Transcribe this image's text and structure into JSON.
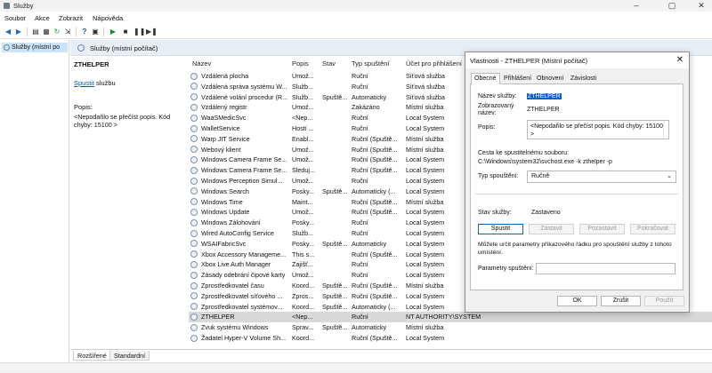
{
  "window": {
    "title": "Služby",
    "controls": [
      "–",
      "▢",
      "✕"
    ]
  },
  "menu": [
    "Soubor",
    "Akce",
    "Zobrazit",
    "Nápověda"
  ],
  "toolbar": {
    "icons": [
      "back-arrow-icon",
      "forward-arrow-icon",
      "console-tree-icon",
      "properties-icon",
      "refresh-icon",
      "export-icon",
      "help-icon",
      "show-action-pane-icon",
      "play-icon",
      "stop-icon",
      "pause-icon",
      "restart-icon"
    ]
  },
  "tree": {
    "selected": "Služby (místní po"
  },
  "main": {
    "header": "Služby (místní počítač)",
    "description": {
      "service_name": "ZTHELPER",
      "start_link": "Spustit",
      "start_suffix": " službu",
      "popis_label": "Popis:",
      "popis_text": "<Nepodařilo se přečíst popis. Kód chyby: 15100 >"
    },
    "columns": [
      "Název",
      "Popis",
      "Stav",
      "Typ spuštění",
      "Účet pro přihlášení"
    ],
    "rows": [
      {
        "name": "Vzdálená plocha",
        "desc": "Umož...",
        "status": "",
        "startup": "Ruční",
        "account": "Síťová služba"
      },
      {
        "name": "Vzdálená správa systému W...",
        "desc": "Služb...",
        "status": "",
        "startup": "Ruční",
        "account": "Síťová služba"
      },
      {
        "name": "Vzdálené volání procedur (R...",
        "desc": "Služb...",
        "status": "Spuště...",
        "startup": "Automaticky",
        "account": "Síťová služba"
      },
      {
        "name": "Vzdálený registr",
        "desc": "Umož...",
        "status": "",
        "startup": "Zakázáno",
        "account": "Místní služba"
      },
      {
        "name": "WaaSMedicSvc",
        "desc": "<Nep...",
        "status": "",
        "startup": "Ruční",
        "account": "Local System"
      },
      {
        "name": "WalletService",
        "desc": "Hostí ...",
        "status": "",
        "startup": "Ruční",
        "account": "Local System"
      },
      {
        "name": "Warp JIT Service",
        "desc": "Enabl...",
        "status": "",
        "startup": "Ruční (Spuště...",
        "account": "Místní služba"
      },
      {
        "name": "Webový klient",
        "desc": "Umož...",
        "status": "",
        "startup": "Ruční (Spuště...",
        "account": "Místní služba"
      },
      {
        "name": "Windows Camera Frame Se...",
        "desc": "Umož...",
        "status": "",
        "startup": "Ruční (Spuště...",
        "account": "Local System"
      },
      {
        "name": "Windows Camera Frame Se...",
        "desc": "Sleduj...",
        "status": "",
        "startup": "Ruční (Spuště...",
        "account": "Local System"
      },
      {
        "name": "Windows Perception Simul...",
        "desc": "Umož...",
        "status": "",
        "startup": "Ruční",
        "account": "Local System"
      },
      {
        "name": "Windows Search",
        "desc": "Posky...",
        "status": "Spuště...",
        "startup": "Automaticky (...",
        "account": "Local System"
      },
      {
        "name": "Windows Time",
        "desc": "Maint...",
        "status": "",
        "startup": "Ruční (Spuště...",
        "account": "Místní služba"
      },
      {
        "name": "Windows Update",
        "desc": "Umož...",
        "status": "",
        "startup": "Ruční (Spuště...",
        "account": "Local System"
      },
      {
        "name": "Windows Zálohování",
        "desc": "Posky...",
        "status": "",
        "startup": "Ruční",
        "account": "Local System"
      },
      {
        "name": "Wired AutoConfig Service",
        "desc": "Služb...",
        "status": "",
        "startup": "Ruční",
        "account": "Local System"
      },
      {
        "name": "WSAIFabricSvc",
        "desc": "Posky...",
        "status": "Spuště...",
        "startup": "Automaticky",
        "account": "Local System"
      },
      {
        "name": "Xbox Accessory Manageme...",
        "desc": "This s...",
        "status": "",
        "startup": "Ruční (Spuště...",
        "account": "Local System"
      },
      {
        "name": "Xbox Live Auth Manager",
        "desc": "Zajišť...",
        "status": "",
        "startup": "Ruční",
        "account": "Local System"
      },
      {
        "name": "Zásady odebrání čipové karty",
        "desc": "Umož...",
        "status": "",
        "startup": "Ruční",
        "account": "Local System"
      },
      {
        "name": "Zprostředkovatel času",
        "desc": "Koord...",
        "status": "Spuště...",
        "startup": "Ruční (Spuště...",
        "account": "Místní služba"
      },
      {
        "name": "Zprostředkovatel síťového ...",
        "desc": "Zpros...",
        "status": "Spuště...",
        "startup": "Ruční (Spuště...",
        "account": "Local System"
      },
      {
        "name": "Zprostředkovatel systémov...",
        "desc": "Koord...",
        "status": "Spuště...",
        "startup": "Automaticky (...",
        "account": "Local System"
      },
      {
        "name": "ZTHELPER",
        "desc": "<Nep...",
        "status": "",
        "startup": "Ruční",
        "account": "NT AUTHORITY\\SYSTEM"
      },
      {
        "name": "Zvuk systému Windows",
        "desc": "Sprav...",
        "status": "Spuště...",
        "startup": "Automaticky",
        "account": "Místní služba"
      },
      {
        "name": "Žadatel Hyper-V Volume Sh...",
        "desc": "Koord...",
        "status": "",
        "startup": "Ruční (Spuště...",
        "account": "Local System"
      }
    ],
    "selected_row": 23,
    "view_tabs": [
      "Rozšířené",
      "Standardní"
    ]
  },
  "dialog": {
    "title": "Vlastnosti - ZTHELPER (Místní počítač)",
    "close": "✕",
    "tabs": [
      "Obecné",
      "Přihlášení",
      "Obnovení",
      "Závislosti"
    ],
    "service_name_label": "Název služby:",
    "service_name_value": "ZTHELPER",
    "display_name_label": "Zobrazovaný název:",
    "display_name_value": "ZTHELPER",
    "popis_label": "Popis:",
    "popis_value": "<Nepodařilo se přečíst popis. Kód chyby: 15100 >",
    "exe_label": "Cesta ke spustitelnému souboru:",
    "exe_value": "C:\\Windows\\system32\\svchost.exe -k zthelper -p",
    "startup_label": "Typ spouštění:",
    "startup_value": "Ručně",
    "status_label": "Stav služby:",
    "status_value": "Zastaveno",
    "buttons": {
      "start": "Spustit",
      "stop": "Zastavit",
      "pause": "Pozastavit",
      "resume": "Pokračovat"
    },
    "note": "Můžete určit parametry příkazového řádku pro spouštění služby z tohoto umístění.",
    "params_label": "Parametry spuštění:",
    "footer": {
      "ok": "OK",
      "cancel": "Zrušit",
      "apply": "Použít"
    }
  }
}
